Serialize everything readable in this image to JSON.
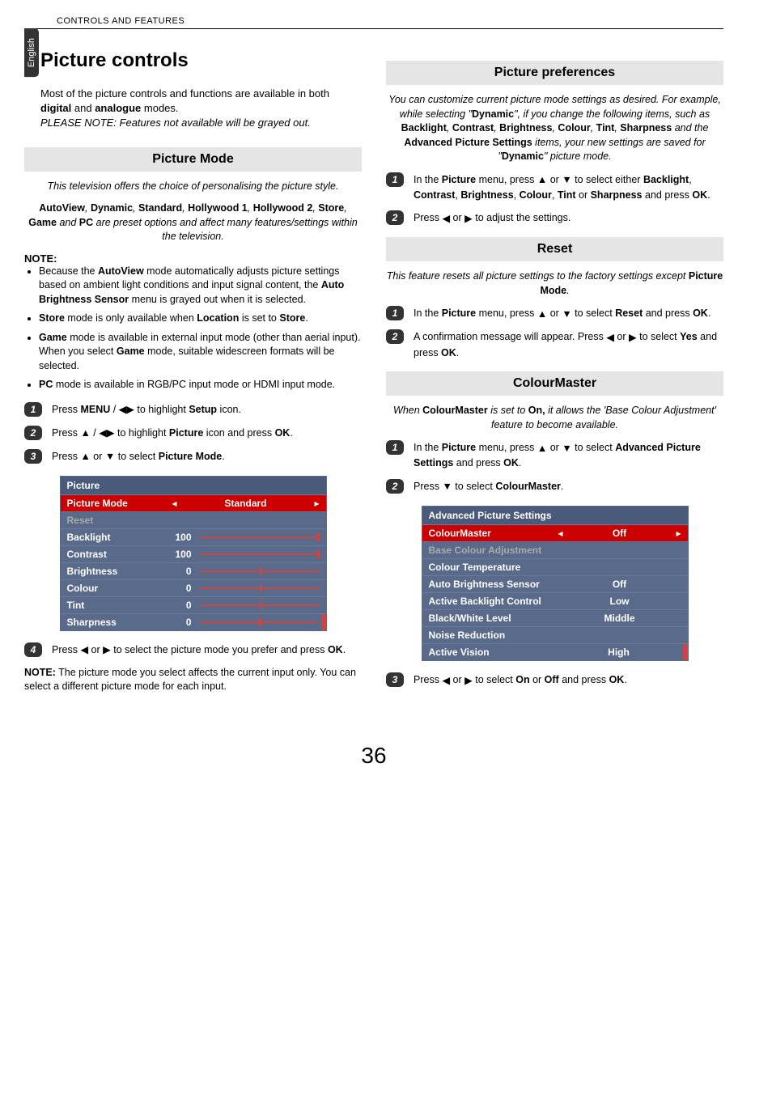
{
  "header": "CONTROLS AND FEATURES",
  "sideTab": "English",
  "pageNumber": "36",
  "left": {
    "title": "Picture controls",
    "intro1": "Most of the picture controls and functions are available in both ",
    "intro1b": "digital",
    "intro1c": " and ",
    "intro1d": "analogue",
    "intro1e": " modes.",
    "intro2": "PLEASE NOTE: Features not available will be grayed out.",
    "pictureMode": {
      "heading": "Picture Mode",
      "tagline": "This television offers the choice of personalising the picture style.",
      "presets1a": "AutoView",
      "presets1b": ", ",
      "presets1c": "Dynamic",
      "presets1d": ", ",
      "presets1e": "Standard",
      "presets1f": ", ",
      "presets1g": "Hollywood 1",
      "presets1h": ", ",
      "presets1i": "Hollywood 2",
      "presets1j": ", ",
      "presets1k": "Store",
      "presets1l": ", ",
      "presets1m": "Game",
      "presets1n": " and ",
      "presets1o": "PC",
      "presets1p": " are preset options and affect many features/settings within the television.",
      "noteLabel": "NOTE:",
      "n1a": "Because the ",
      "n1b": "AutoView",
      "n1c": " mode automatically adjusts picture settings based on ambient light conditions and input signal content, the ",
      "n1d": "Auto Brightness Sensor",
      "n1e": " menu is grayed out when it is selected.",
      "n2a": "Store",
      "n2b": " mode is only available when ",
      "n2c": "Location",
      "n2d": " is set to ",
      "n2e": "Store",
      "n2f": ".",
      "n3a": "Game",
      "n3b": " mode is available in external input mode (other than aerial input). When you select ",
      "n3c": "Game",
      "n3d": " mode, suitable widescreen formats will be selected.",
      "n4a": "PC",
      "n4b": " mode is available in RGB/PC input mode or HDMI input mode.",
      "s1a": "Press ",
      "s1b": "MENU",
      "s1c": " / ",
      "s1d": " to highlight ",
      "s1e": "Setup",
      "s1f": " icon.",
      "s2a": "Press ",
      "s2b": " / ",
      "s2c": " to highlight ",
      "s2d": "Picture",
      "s2e": " icon and press ",
      "s2f": "OK",
      "s2g": ".",
      "s3a": "Press ",
      "s3b": " or ",
      "s3c": " to select ",
      "s3d": "Picture Mode",
      "s3e": ".",
      "s4a": "Press ",
      "s4b": " or ",
      "s4c": " to select the picture mode you prefer and press ",
      "s4d": "OK",
      "s4e": ".",
      "finalNoteA": "NOTE:",
      "finalNoteB": " The picture mode you select affects the current input only. You can select a different picture mode for each input."
    },
    "osd1": {
      "title": "Picture",
      "r1": "Picture Mode",
      "r1v": "Standard",
      "r2": "Reset",
      "r3": "Backlight",
      "r3v": "100",
      "r4": "Contrast",
      "r4v": "100",
      "r5": "Brightness",
      "r5v": "0",
      "r6": "Colour",
      "r6v": "0",
      "r7": "Tint",
      "r7v": "0",
      "r8": "Sharpness",
      "r8v": "0"
    }
  },
  "right": {
    "prefs": {
      "heading": "Picture preferences",
      "desc1": "You can customize current picture mode settings as desired. For example, while selecting \"",
      "desc1b": "Dynamic",
      "desc1c": "\", if you change the following items, such as ",
      "desc1d": "Backlight",
      "desc1e": ", ",
      "desc1f": "Contrast",
      "desc1g": ", ",
      "desc1h": "Brightness",
      "desc1i": ", ",
      "desc1j": "Colour",
      "desc1k": ", ",
      "desc1l": "Tint",
      "desc1m": ", ",
      "desc1n": "Sharpness",
      "desc1o": " and the ",
      "desc1p": "Advanced Picture Settings",
      "desc1q": " items, your new settings are saved for \"",
      "desc1r": "Dynamic",
      "desc1s": "\" picture mode.",
      "s1a": "In the ",
      "s1b": "Picture",
      "s1c": " menu, press ",
      "s1d": " or ",
      "s1e": " to select either ",
      "s1f": "Backlight",
      "s1g": ", ",
      "s1h": "Contrast",
      "s1i": ", ",
      "s1j": "Brightness",
      "s1k": ", ",
      "s1l": "Colour",
      "s1m": ", ",
      "s1n": "Tint",
      "s1o": " or ",
      "s1p": "Sharpness",
      "s1q": " and press ",
      "s1r": "OK",
      "s1s": ".",
      "s2a": "Press ",
      "s2b": " or ",
      "s2c": " to adjust the settings."
    },
    "reset": {
      "heading": "Reset",
      "desc1": "This feature resets all picture settings to the factory settings except ",
      "desc1b": "Picture Mode",
      "desc1c": ".",
      "s1a": "In the ",
      "s1b": "Picture",
      "s1c": " menu, press ",
      "s1d": " or ",
      "s1e": " to select ",
      "s1f": "Reset",
      "s1g": " and press ",
      "s1h": "OK",
      "s1i": ".",
      "s2a": "A confirmation message will appear. Press ",
      "s2b": " or ",
      "s2c": " to select ",
      "s2d": "Yes",
      "s2e": " and press ",
      "s2f": "OK",
      "s2g": "."
    },
    "cm": {
      "heading": "ColourMaster",
      "desc1": "When ",
      "desc1b": "ColourMaster",
      "desc1c": " is set to ",
      "desc1d": "On,",
      "desc1e": " it allows the 'Base Colour Adjustment' feature to become available.",
      "s1a": "In the ",
      "s1b": "Picture",
      "s1c": " menu, press ",
      "s1d": " or ",
      "s1e": " to select ",
      "s1f": "Advanced Picture Settings",
      "s1g": " and press ",
      "s1h": "OK",
      "s1i": ".",
      "s2a": "Press ",
      "s2b": " to select ",
      "s2c": "ColourMaster",
      "s2d": ".",
      "s3a": "Press ",
      "s3b": " or ",
      "s3c": " to select ",
      "s3d": "On",
      "s3e": " or ",
      "s3f": "Off",
      "s3g": " and press ",
      "s3h": "OK",
      "s3i": "."
    },
    "osd2": {
      "title": "Advanced Picture Settings",
      "r1": "ColourMaster",
      "r1v": "Off",
      "r2": "Base Colour Adjustment",
      "r3": "Colour Temperature",
      "r4": "Auto Brightness Sensor",
      "r4v": "Off",
      "r5": "Active Backlight Control",
      "r5v": "Low",
      "r6": "Black/White Level",
      "r6v": "Middle",
      "r7": "Noise Reduction",
      "r8": "Active Vision",
      "r8v": "High"
    }
  }
}
